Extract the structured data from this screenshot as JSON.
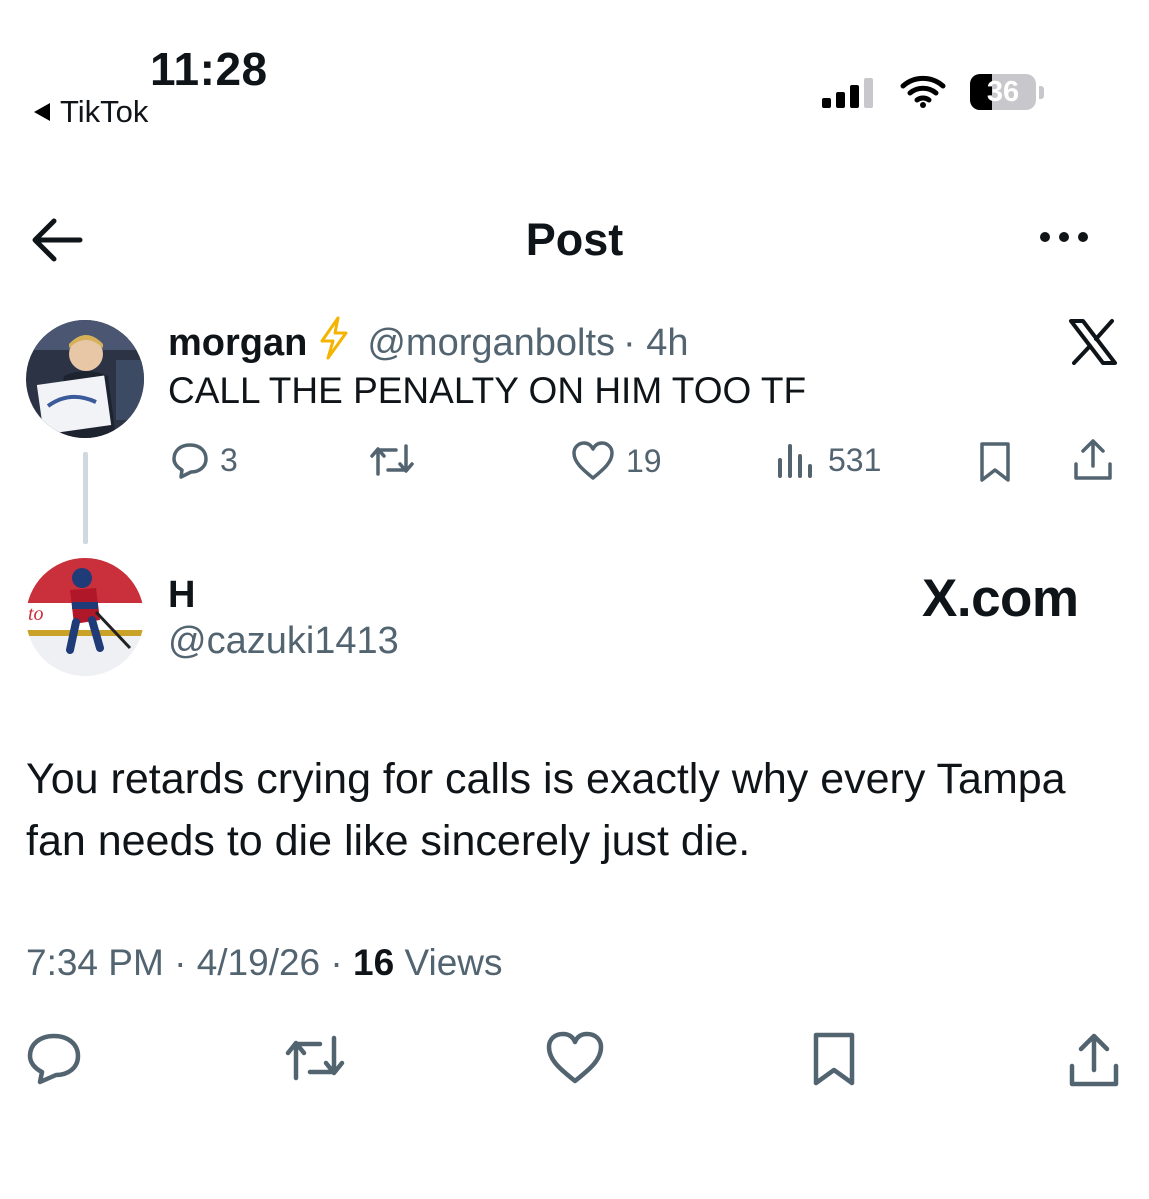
{
  "status_bar": {
    "time": "11:28",
    "back_app": "TikTok",
    "battery": "36"
  },
  "header": {
    "title": "Post"
  },
  "quoted_tweet": {
    "name": "morgan",
    "handle": "@morganbolts",
    "time": "· 4h",
    "text": "CALL THE PENALTY ON HIM TOO TF",
    "replies": "3",
    "likes": "19",
    "views": "531"
  },
  "main_tweet": {
    "name": "H",
    "handle": "@cazuki1413",
    "watermark": "X.com",
    "text": "You retards crying for calls is exactly why every Tampa fan needs to die like sincerely just die.",
    "time": "7:34 PM",
    "date": "4/19/26",
    "views_count": "16",
    "views_label": "Views"
  },
  "colors": {
    "text": "#0f1419",
    "secondary": "#536471",
    "divider": "#cfd9de",
    "bolt": "#f4b400"
  }
}
